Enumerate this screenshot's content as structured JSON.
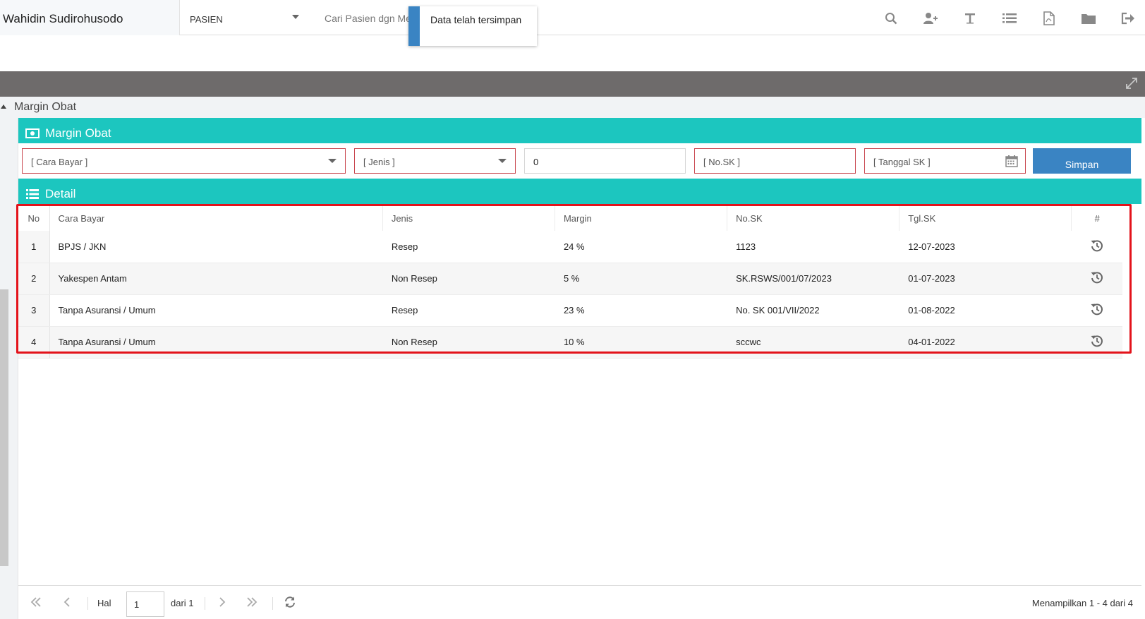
{
  "topbar": {
    "brand": "Wahidin Sudirohusodo",
    "patient_select": "PASIEN",
    "search_text": "Cari Pasien dgn Media No.Kartu BPJS/Nama"
  },
  "toast": {
    "message": "Data telah tersimpan"
  },
  "panel": {
    "title": "Margin Obat"
  },
  "form": {
    "header": "Margin Obat",
    "cara_bayar": "[ Cara Bayar ]",
    "jenis": "[ Jenis ]",
    "margin_value": "0",
    "no_sk": "[ No.SK ]",
    "tanggal_sk": "[ Tanggal SK ]",
    "save_label": "Simpan"
  },
  "detail": {
    "header": "Detail",
    "columns": [
      "No",
      "Cara Bayar",
      "Jenis",
      "Margin",
      "No.SK",
      "Tgl.SK",
      "#"
    ],
    "rows": [
      [
        "1",
        "BPJS / JKN",
        "Resep",
        "24 %",
        "1123",
        "12-07-2023"
      ],
      [
        "2",
        "Yakespen Antam",
        "Non Resep",
        "5 %",
        "SK.RSWS/001/07/2023",
        "01-07-2023"
      ],
      [
        "3",
        "Tanpa Asuransi / Umum",
        "Resep",
        "23 %",
        "No. SK 001/VII/2022",
        "01-08-2022"
      ],
      [
        "4",
        "Tanpa Asuransi / Umum",
        "Non Resep",
        "10 %",
        "sccwc",
        "04-01-2022"
      ]
    ]
  },
  "pager": {
    "hal_label": "Hal",
    "page": "1",
    "of_label": "dari 1",
    "summary": "Menampilkan 1 - 4 dari 4"
  },
  "colors": {
    "teal": "#1cc6bf",
    "primary": "#3a84c3",
    "highlight": "#e3131b",
    "band": "#6e6b6b"
  }
}
